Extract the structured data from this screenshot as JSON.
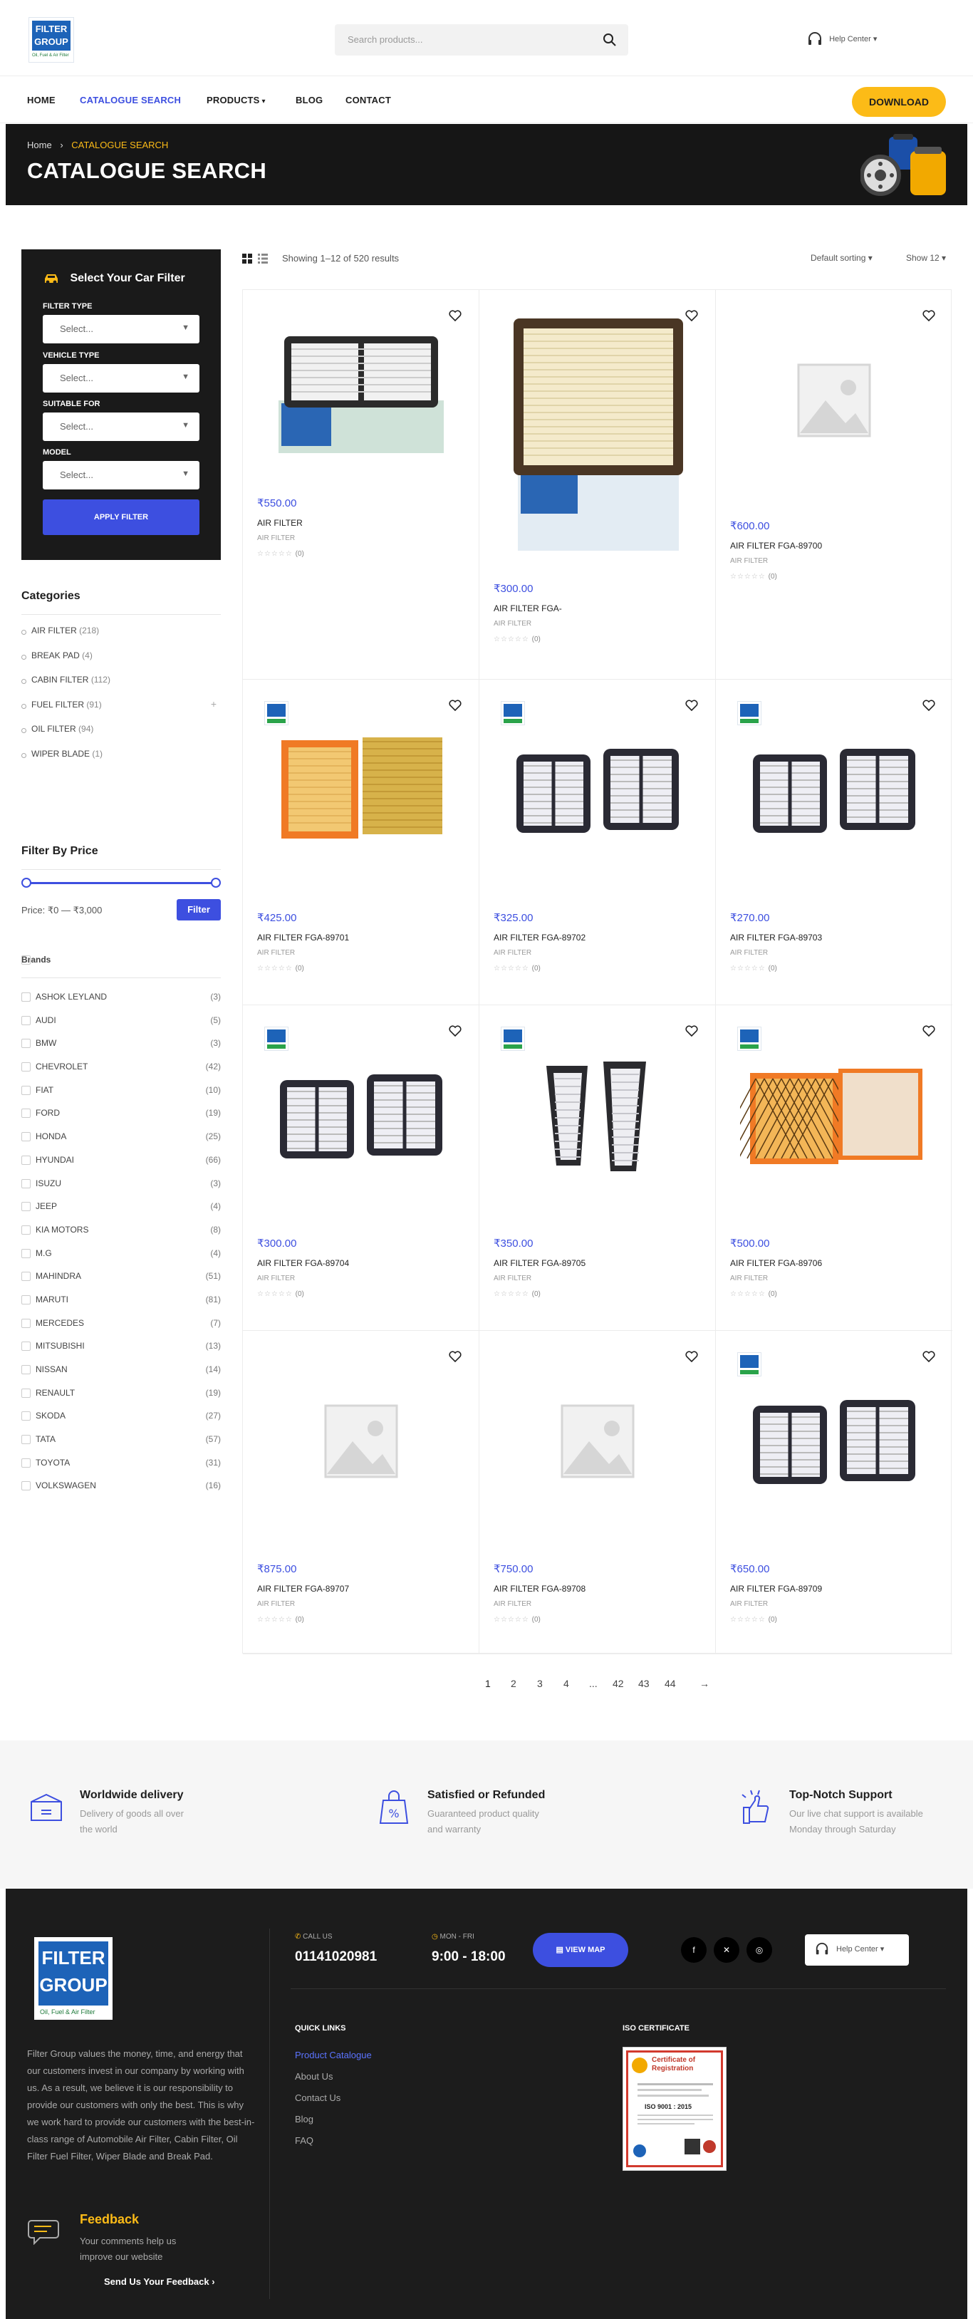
{
  "header": {
    "logo_line1": "FILTER",
    "logo_line2": "GROUP",
    "logo_tagline": "Oil, Fuel & Air Filter",
    "search_placeholder": "Search products...",
    "help_center": "Help Center"
  },
  "nav": {
    "items": [
      "HOME",
      "CATALOGUE SEARCH",
      "PRODUCTS",
      "BLOG",
      "CONTACT"
    ],
    "active": "CATALOGUE SEARCH",
    "download": "DOWNLOAD"
  },
  "hero": {
    "crumb_home": "Home",
    "crumb_sep": "›",
    "crumb_current": "CATALOGUE SEARCH",
    "title": "CATALOGUE SEARCH"
  },
  "car_filter": {
    "heading": "Select Your Car Filter",
    "fields": [
      {
        "label": "FILTER TYPE",
        "value": "Select..."
      },
      {
        "label": "VEHICLE TYPE",
        "value": "Select..."
      },
      {
        "label": "SUITABLE FOR",
        "value": "Select..."
      },
      {
        "label": "MODEL",
        "value": "Select..."
      }
    ],
    "apply": "APPLY FILTER"
  },
  "categories": {
    "title": "Categories",
    "items": [
      {
        "label": "AIR FILTER",
        "count": "(218)"
      },
      {
        "label": "BREAK PAD",
        "count": "(4)"
      },
      {
        "label": "CABIN FILTER",
        "count": "(112)"
      },
      {
        "label": "FUEL FILTER",
        "count": "(91)"
      },
      {
        "label": "OIL FILTER",
        "count": "(94)"
      },
      {
        "label": "WIPER BLADE",
        "count": "(1)"
      }
    ],
    "expand": "+"
  },
  "price_filter": {
    "title": "Filter By Price",
    "label": "Price: ₹0 — ₹3,000",
    "button": "Filter",
    "min_fraction": 0,
    "max_fraction": 1
  },
  "brands": {
    "title": "Brands",
    "items": [
      {
        "label": "ASHOK LEYLAND",
        "count": "(3)"
      },
      {
        "label": "AUDI",
        "count": "(5)"
      },
      {
        "label": "BMW",
        "count": "(3)"
      },
      {
        "label": "CHEVROLET",
        "count": "(42)"
      },
      {
        "label": "FIAT",
        "count": "(10)"
      },
      {
        "label": "FORD",
        "count": "(19)"
      },
      {
        "label": "HONDA",
        "count": "(25)"
      },
      {
        "label": "HYUNDAI",
        "count": "(66)"
      },
      {
        "label": "ISUZU",
        "count": "(3)"
      },
      {
        "label": "JEEP",
        "count": "(4)"
      },
      {
        "label": "KIA MOTORS",
        "count": "(8)"
      },
      {
        "label": "M.G",
        "count": "(4)"
      },
      {
        "label": "MAHINDRA",
        "count": "(51)"
      },
      {
        "label": "MARUTI",
        "count": "(81)"
      },
      {
        "label": "MERCEDES",
        "count": "(7)"
      },
      {
        "label": "MITSUBISHI",
        "count": "(13)"
      },
      {
        "label": "NISSAN",
        "count": "(14)"
      },
      {
        "label": "RENAULT",
        "count": "(19)"
      },
      {
        "label": "SKODA",
        "count": "(27)"
      },
      {
        "label": "TATA",
        "count": "(57)"
      },
      {
        "label": "TOYOTA",
        "count": "(31)"
      },
      {
        "label": "VOLKSWAGEN",
        "count": "(16)"
      }
    ]
  },
  "toolbar": {
    "result_count": "Showing 1–12 of 520 results",
    "sorting": "Default sorting",
    "show": "Show 12"
  },
  "products": [
    {
      "price": "₹550.00",
      "name": "AIR FILTER",
      "category": "AIR FILTER",
      "reviews": "(0)",
      "image": "filter-box-icon",
      "badge": false
    },
    {
      "price": "₹300.00",
      "name": "AIR FILTER FGA-",
      "category": "AIR FILTER",
      "reviews": "(0)",
      "image": "filter-box-large-icon",
      "badge": false
    },
    {
      "price": "₹600.00",
      "name": "AIR FILTER FGA-89700",
      "category": "AIR FILTER",
      "reviews": "(0)",
      "image": "placeholder-icon",
      "badge": false
    },
    {
      "price": "₹425.00",
      "name": "AIR FILTER FGA-89701",
      "category": "AIR FILTER",
      "reviews": "(0)",
      "image": "panel-orange-icon",
      "badge": true
    },
    {
      "price": "₹325.00",
      "name": "AIR FILTER FGA-89702",
      "category": "AIR FILTER",
      "reviews": "(0)",
      "image": "panel-pair-icon",
      "badge": true
    },
    {
      "price": "₹270.00",
      "name": "AIR FILTER FGA-89703",
      "category": "AIR FILTER",
      "reviews": "(0)",
      "image": "panel-pair-icon",
      "badge": true
    },
    {
      "price": "₹300.00",
      "name": "AIR FILTER FGA-89704",
      "category": "AIR FILTER",
      "reviews": "(0)",
      "image": "panel-pair-icon",
      "badge": true
    },
    {
      "price": "₹350.00",
      "name": "AIR FILTER FGA-89705",
      "category": "AIR FILTER",
      "reviews": "(0)",
      "image": "panel-tall-icon",
      "badge": true
    },
    {
      "price": "₹500.00",
      "name": "AIR FILTER FGA-89706",
      "category": "AIR FILTER",
      "reviews": "(0)",
      "image": "panel-mesh-icon",
      "badge": true
    },
    {
      "price": "₹875.00",
      "name": "AIR FILTER FGA-89707",
      "category": "AIR FILTER",
      "reviews": "(0)",
      "image": "placeholder-icon",
      "badge": false
    },
    {
      "price": "₹750.00",
      "name": "AIR FILTER FGA-89708",
      "category": "AIR FILTER",
      "reviews": "(0)",
      "image": "placeholder-icon",
      "badge": false
    },
    {
      "price": "₹650.00",
      "name": "AIR FILTER FGA-89709",
      "category": "AIR FILTER",
      "reviews": "(0)",
      "image": "panel-pair-icon",
      "badge": true
    }
  ],
  "pagination": [
    "1",
    "2",
    "3",
    "4",
    "...",
    "42",
    "43",
    "44",
    "→"
  ],
  "features": [
    {
      "title": "Worldwide delivery",
      "desc1": "Delivery of goods all over",
      "desc2": "the world",
      "icon": "box-icon"
    },
    {
      "title": "Satisfied or Refunded",
      "desc1": "Guaranteed product quality",
      "desc2": "and warranty",
      "icon": "percent-bag-icon"
    },
    {
      "title": "Top-Notch Support",
      "desc1": "Our live chat support is available",
      "desc2": "Monday through Saturday",
      "icon": "thumbs-up-icon"
    }
  ],
  "footer": {
    "about": "Filter Group values the money, time, and energy that our customers invest in our company by working with us. As a result, we believe it is our responsibility to provide our customers with only the best. This is why we work hard to provide our customers with the best-in-class range of Automobile Air Filter, Cabin Filter, Oil Filter Fuel Filter, Wiper Blade and Break Pad.",
    "call_label": "CALL US",
    "call_value": "01141020981",
    "hours_label": "MON - FRI",
    "hours_value": "9:00 - 18:00",
    "map_button": "VIEW MAP",
    "help_center": "Help Center",
    "quick_links_title": "QUICK LINKS",
    "quick_links": [
      "Product Catalogue",
      "About Us",
      "Contact Us",
      "Blog",
      "FAQ"
    ],
    "iso_title": "ISO CERTIFICATE",
    "cert_title1": "Certificate of",
    "cert_title2": "Registration",
    "cert_iso": "ISO 9001 : 2015",
    "feedback_title": "Feedback",
    "feedback_line1": "Your comments help us",
    "feedback_line2": "improve our website",
    "feedback_link": "Send Us Your Feedback  ›"
  },
  "colors": {
    "accent": "#3d4fe0",
    "yellow": "#fcbb17",
    "dark": "#1a1a1a"
  }
}
